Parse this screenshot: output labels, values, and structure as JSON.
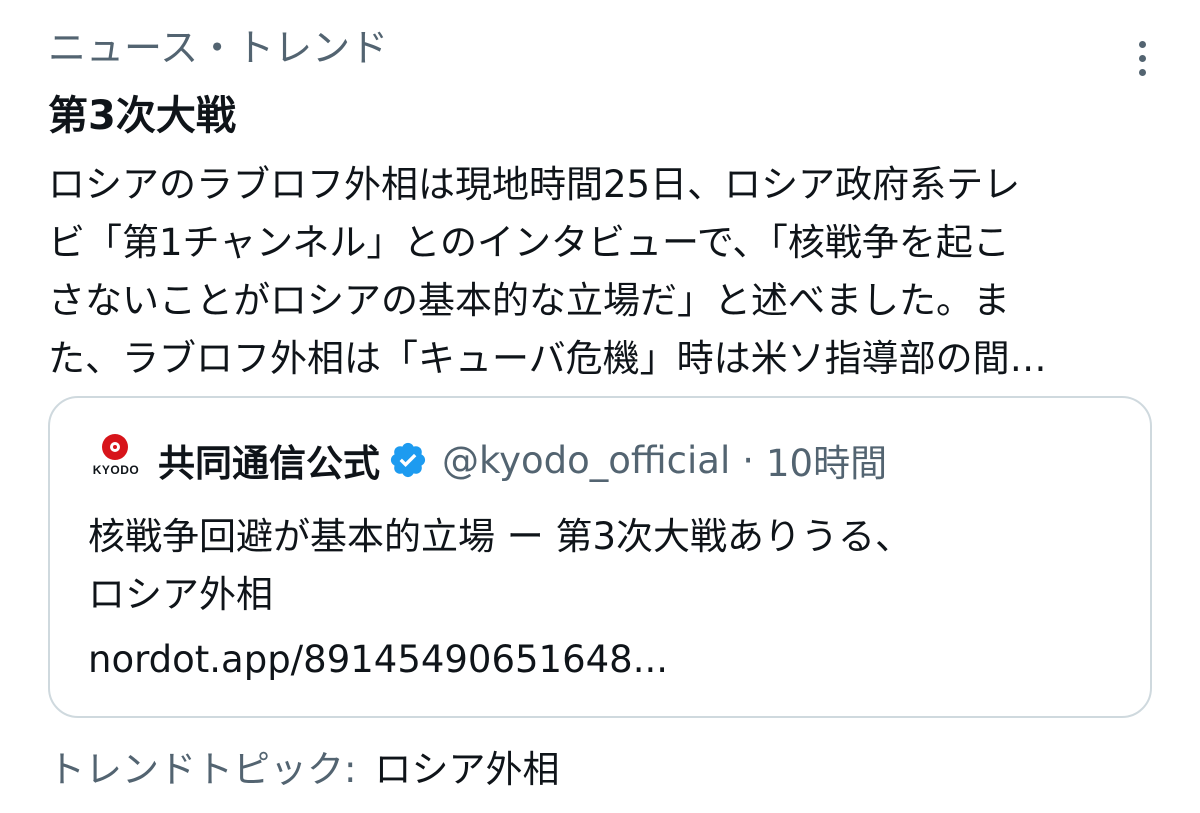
{
  "trend": {
    "category": "ニュース・トレンド",
    "more_icon": "more-vertical-icon",
    "title": "第3次大戦",
    "description_lines": [
      "ロシアのラブロフ外相は現地時間25日、ロシア政府系テレ",
      "ビ「第1チャンネル」とのインタビューで、「核戦争を起こ",
      "さないことがロシアの基本的な立場だ」と述べました。ま",
      "た、ラブロフ外相は「キューバ危機」時は米ソ指導部の間…"
    ]
  },
  "quote": {
    "avatar_icon": "kyodo-logo-icon",
    "logo_text": "KYODO",
    "display_name": "共同通信公式",
    "verified_icon": "verified-badge-icon",
    "handle": "@kyodo_official",
    "separator": "·",
    "timestamp": "10時間",
    "text_lines": [
      "核戦争回避が基本的立場 ー 第3次大戦ありうる、",
      "ロシア外相"
    ],
    "link": "nordot.app/89145490651648..."
  },
  "trending_topic": {
    "label": "トレンドトピック:",
    "value": "ロシア外相"
  },
  "colors": {
    "primary_text": "#0f1419",
    "secondary_text": "#536471",
    "border": "#cfd9de",
    "verified_blue": "#1d9bf0",
    "kyodo_red": "#d7141a"
  }
}
